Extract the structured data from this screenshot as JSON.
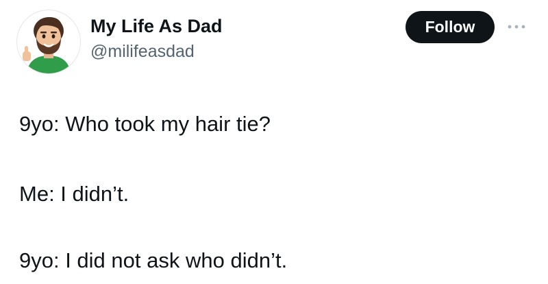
{
  "author": {
    "display_name": "My Life As Dad",
    "handle": "@milifeasdad",
    "avatar_icon": "bitmoji-dad-thumbs-up-avatar"
  },
  "actions": {
    "follow_label": "Follow",
    "more_icon": "more-options-icon"
  },
  "tweet": {
    "lines": [
      "9yo: Who took my hair tie?",
      "Me: I didn’t.",
      "9yo: I did not ask who didn’t."
    ]
  },
  "colors": {
    "text_primary": "#0f1419",
    "text_secondary": "#536471",
    "follow_bg": "#0f1419",
    "follow_text": "#ffffff",
    "more_dots": "#a8b3bd"
  }
}
